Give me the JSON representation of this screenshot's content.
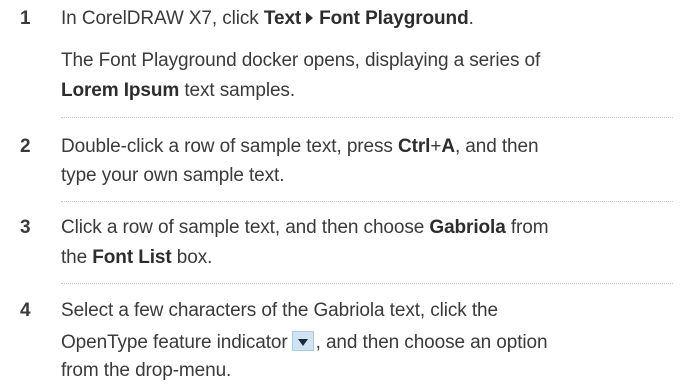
{
  "steps": [
    {
      "number": "1",
      "lines": [
        {
          "pre": "In CorelDRAW X7, click ",
          "bold1": "Text",
          "bold2": "Font Playground",
          "post": "."
        },
        {
          "text": "The Font Playground docker opens, displaying a series of"
        },
        {
          "bold": "Lorem Ipsum",
          "post": " text samples."
        }
      ]
    },
    {
      "number": "2",
      "lines": [
        {
          "pre": "Double-click a row of sample text, press ",
          "bold1": "Ctrl",
          "mid": "+",
          "bold2": "A",
          "post": ", and then"
        },
        {
          "text": "type your own sample text."
        }
      ]
    },
    {
      "number": "3",
      "lines": [
        {
          "pre": "Click a row of sample text, and then choose ",
          "bold": "Gabriola",
          "post": " from"
        },
        {
          "pre": "the ",
          "bold": "Font List",
          "post": " box."
        }
      ]
    },
    {
      "number": "4",
      "lines": [
        {
          "text": "Select a few characters of the Gabriola text, click the"
        },
        {
          "pre": "OpenType feature indicator",
          "post": ", and then choose an option"
        },
        {
          "text": "from the drop-menu."
        }
      ]
    }
  ]
}
